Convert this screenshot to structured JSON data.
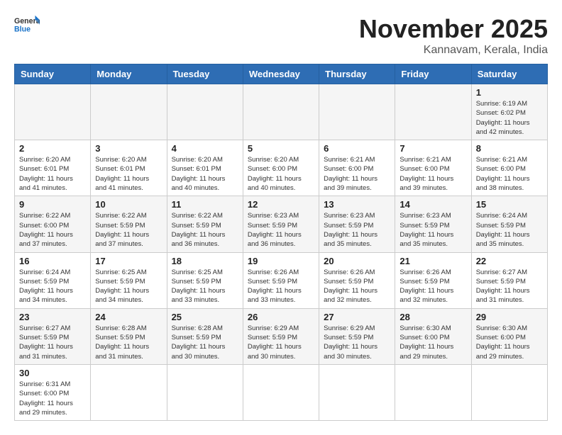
{
  "header": {
    "logo_general": "General",
    "logo_blue": "Blue",
    "month": "November 2025",
    "location": "Kannavam, Kerala, India"
  },
  "weekdays": [
    "Sunday",
    "Monday",
    "Tuesday",
    "Wednesday",
    "Thursday",
    "Friday",
    "Saturday"
  ],
  "weeks": [
    [
      {
        "day": "",
        "info": ""
      },
      {
        "day": "",
        "info": ""
      },
      {
        "day": "",
        "info": ""
      },
      {
        "day": "",
        "info": ""
      },
      {
        "day": "",
        "info": ""
      },
      {
        "day": "",
        "info": ""
      },
      {
        "day": "1",
        "info": "Sunrise: 6:19 AM\nSunset: 6:02 PM\nDaylight: 11 hours\nand 42 minutes."
      }
    ],
    [
      {
        "day": "2",
        "info": "Sunrise: 6:20 AM\nSunset: 6:01 PM\nDaylight: 11 hours\nand 41 minutes."
      },
      {
        "day": "3",
        "info": "Sunrise: 6:20 AM\nSunset: 6:01 PM\nDaylight: 11 hours\nand 41 minutes."
      },
      {
        "day": "4",
        "info": "Sunrise: 6:20 AM\nSunset: 6:01 PM\nDaylight: 11 hours\nand 40 minutes."
      },
      {
        "day": "5",
        "info": "Sunrise: 6:20 AM\nSunset: 6:00 PM\nDaylight: 11 hours\nand 40 minutes."
      },
      {
        "day": "6",
        "info": "Sunrise: 6:21 AM\nSunset: 6:00 PM\nDaylight: 11 hours\nand 39 minutes."
      },
      {
        "day": "7",
        "info": "Sunrise: 6:21 AM\nSunset: 6:00 PM\nDaylight: 11 hours\nand 39 minutes."
      },
      {
        "day": "8",
        "info": "Sunrise: 6:21 AM\nSunset: 6:00 PM\nDaylight: 11 hours\nand 38 minutes."
      }
    ],
    [
      {
        "day": "9",
        "info": "Sunrise: 6:22 AM\nSunset: 6:00 PM\nDaylight: 11 hours\nand 37 minutes."
      },
      {
        "day": "10",
        "info": "Sunrise: 6:22 AM\nSunset: 5:59 PM\nDaylight: 11 hours\nand 37 minutes."
      },
      {
        "day": "11",
        "info": "Sunrise: 6:22 AM\nSunset: 5:59 PM\nDaylight: 11 hours\nand 36 minutes."
      },
      {
        "day": "12",
        "info": "Sunrise: 6:23 AM\nSunset: 5:59 PM\nDaylight: 11 hours\nand 36 minutes."
      },
      {
        "day": "13",
        "info": "Sunrise: 6:23 AM\nSunset: 5:59 PM\nDaylight: 11 hours\nand 35 minutes."
      },
      {
        "day": "14",
        "info": "Sunrise: 6:23 AM\nSunset: 5:59 PM\nDaylight: 11 hours\nand 35 minutes."
      },
      {
        "day": "15",
        "info": "Sunrise: 6:24 AM\nSunset: 5:59 PM\nDaylight: 11 hours\nand 35 minutes."
      }
    ],
    [
      {
        "day": "16",
        "info": "Sunrise: 6:24 AM\nSunset: 5:59 PM\nDaylight: 11 hours\nand 34 minutes."
      },
      {
        "day": "17",
        "info": "Sunrise: 6:25 AM\nSunset: 5:59 PM\nDaylight: 11 hours\nand 34 minutes."
      },
      {
        "day": "18",
        "info": "Sunrise: 6:25 AM\nSunset: 5:59 PM\nDaylight: 11 hours\nand 33 minutes."
      },
      {
        "day": "19",
        "info": "Sunrise: 6:26 AM\nSunset: 5:59 PM\nDaylight: 11 hours\nand 33 minutes."
      },
      {
        "day": "20",
        "info": "Sunrise: 6:26 AM\nSunset: 5:59 PM\nDaylight: 11 hours\nand 32 minutes."
      },
      {
        "day": "21",
        "info": "Sunrise: 6:26 AM\nSunset: 5:59 PM\nDaylight: 11 hours\nand 32 minutes."
      },
      {
        "day": "22",
        "info": "Sunrise: 6:27 AM\nSunset: 5:59 PM\nDaylight: 11 hours\nand 31 minutes."
      }
    ],
    [
      {
        "day": "23",
        "info": "Sunrise: 6:27 AM\nSunset: 5:59 PM\nDaylight: 11 hours\nand 31 minutes."
      },
      {
        "day": "24",
        "info": "Sunrise: 6:28 AM\nSunset: 5:59 PM\nDaylight: 11 hours\nand 31 minutes."
      },
      {
        "day": "25",
        "info": "Sunrise: 6:28 AM\nSunset: 5:59 PM\nDaylight: 11 hours\nand 30 minutes."
      },
      {
        "day": "26",
        "info": "Sunrise: 6:29 AM\nSunset: 5:59 PM\nDaylight: 11 hours\nand 30 minutes."
      },
      {
        "day": "27",
        "info": "Sunrise: 6:29 AM\nSunset: 5:59 PM\nDaylight: 11 hours\nand 30 minutes."
      },
      {
        "day": "28",
        "info": "Sunrise: 6:30 AM\nSunset: 6:00 PM\nDaylight: 11 hours\nand 29 minutes."
      },
      {
        "day": "29",
        "info": "Sunrise: 6:30 AM\nSunset: 6:00 PM\nDaylight: 11 hours\nand 29 minutes."
      }
    ],
    [
      {
        "day": "30",
        "info": "Sunrise: 6:31 AM\nSunset: 6:00 PM\nDaylight: 11 hours\nand 29 minutes."
      },
      {
        "day": "",
        "info": ""
      },
      {
        "day": "",
        "info": ""
      },
      {
        "day": "",
        "info": ""
      },
      {
        "day": "",
        "info": ""
      },
      {
        "day": "",
        "info": ""
      },
      {
        "day": "",
        "info": ""
      }
    ]
  ]
}
